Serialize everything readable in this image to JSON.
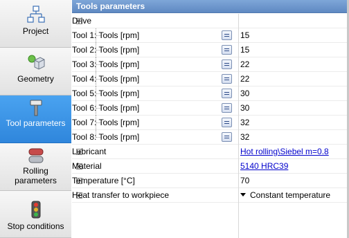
{
  "sidebar": {
    "items": [
      {
        "label": "Project",
        "icon": "project-tree-icon",
        "active": false
      },
      {
        "label": "Geometry",
        "icon": "geometry-cube-icon",
        "active": false
      },
      {
        "label": "Tool parameters",
        "icon": "hammer-icon",
        "active": true
      },
      {
        "label": "Rolling parameters",
        "icon": "rolling-icon",
        "active": false
      },
      {
        "label": "Stop conditions",
        "icon": "traffic-light-icon",
        "active": false
      }
    ]
  },
  "panel": {
    "title": "Tools parameters"
  },
  "drive": {
    "label": "Drive",
    "tools": [
      {
        "label": "Tool 1: Tools [rpm]",
        "value": "15"
      },
      {
        "label": "Tool 2: Tools [rpm]",
        "value": "15"
      },
      {
        "label": "Tool 3: Tools [rpm]",
        "value": "22"
      },
      {
        "label": "Tool 4: Tools [rpm]",
        "value": "22"
      },
      {
        "label": "Tool 5: Tools [rpm]",
        "value": "30"
      },
      {
        "label": "Tool 6: Tools [rpm]",
        "value": "30"
      },
      {
        "label": "Tool 7: Tools [rpm]",
        "value": "32"
      },
      {
        "label": "Tool 8: Tools [rpm]",
        "value": "32"
      }
    ]
  },
  "properties": {
    "lubricant": {
      "label": "Lubricant",
      "value": "Hot rolling\\Siebel m=0.8"
    },
    "material": {
      "label": "Material",
      "value": "5140 HRC39"
    },
    "temperature": {
      "label": "Temperature [°C]",
      "value": "70"
    },
    "heat_transfer": {
      "label": "Heat transfer to workpiece",
      "value": "Constant temperature"
    }
  },
  "colors": {
    "active_nav": "#2f86dc",
    "title_bar": "#6a93c9",
    "link": "#0000cc"
  }
}
